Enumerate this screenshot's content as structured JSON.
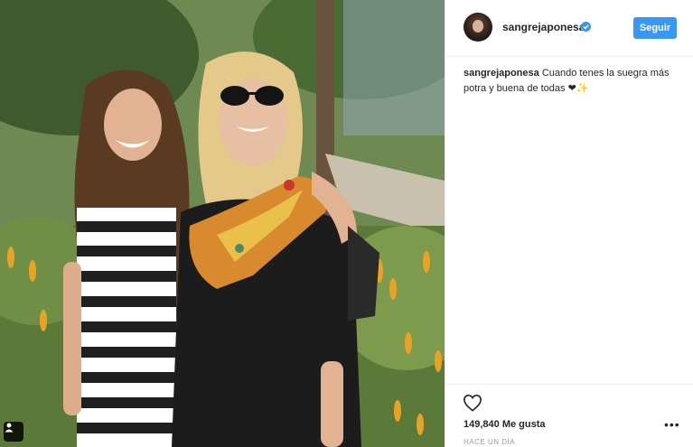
{
  "post": {
    "username": "sangrejaponesa",
    "verified": true,
    "follow_label": "Seguir",
    "caption_user": "sangrejaponesa",
    "caption_text": "Cuando tenes la suegra más potra y buena de todas ❤✨",
    "likes": "149,840 Me gusta",
    "timestamp": "HACE UN DÍA"
  },
  "icons": {
    "avatar": "profile-avatar",
    "verified": "verified-badge-icon",
    "like": "heart-icon",
    "more": "more-options-icon",
    "user_tag": "user-tag-icon"
  },
  "colors": {
    "accent": "#3897f0",
    "text": "#262626",
    "muted": "#999999",
    "border": "#efefef"
  }
}
